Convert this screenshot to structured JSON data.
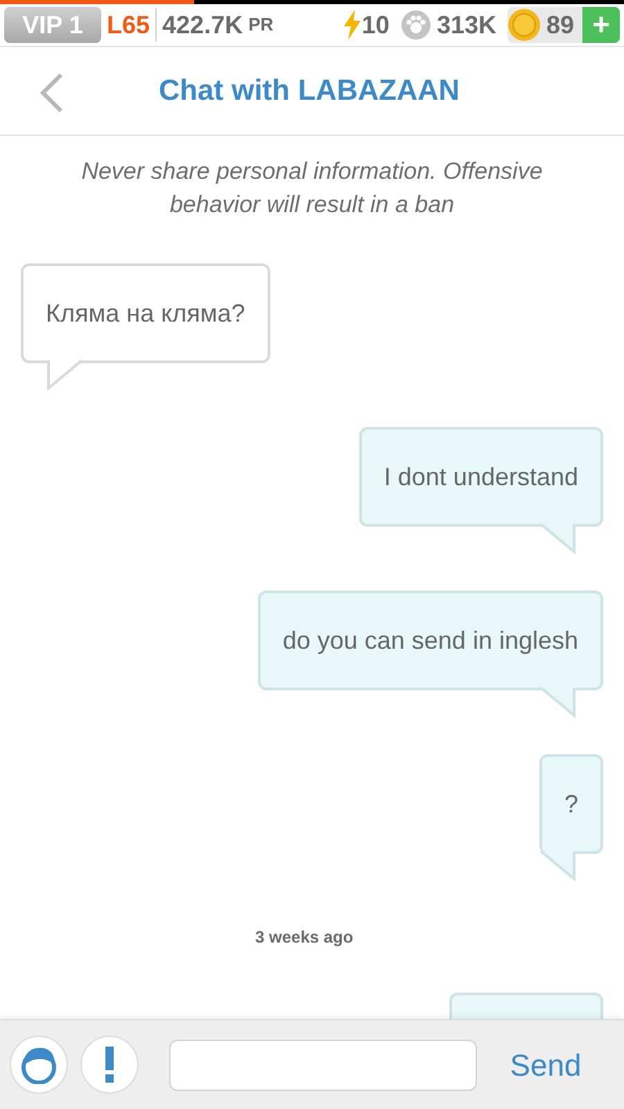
{
  "status_bar": {
    "progress": {
      "level": 0.31
    },
    "vip": "VIP 1",
    "player_level": "L65",
    "pr_value": "422.7K",
    "pr_unit": "PR",
    "energy": "10",
    "paws": "313K",
    "coins": "89",
    "add": "+"
  },
  "header": {
    "title": "Chat with LABAZAAN"
  },
  "notice": "Never share personal information. Offensive behavior will result in a ban",
  "messages": [
    {
      "kind": "message",
      "outgoing": false,
      "text": "Кляма на кляма?"
    },
    {
      "kind": "message",
      "outgoing": true,
      "text": "I dont understand"
    },
    {
      "kind": "message",
      "outgoing": true,
      "text": "do you can send in inglesh"
    },
    {
      "kind": "message",
      "outgoing": true,
      "text": "?"
    },
    {
      "kind": "time",
      "text": "3 weeks ago"
    },
    {
      "kind": "message",
      "outgoing": true
    }
  ],
  "composer": {
    "send": "Send"
  }
}
